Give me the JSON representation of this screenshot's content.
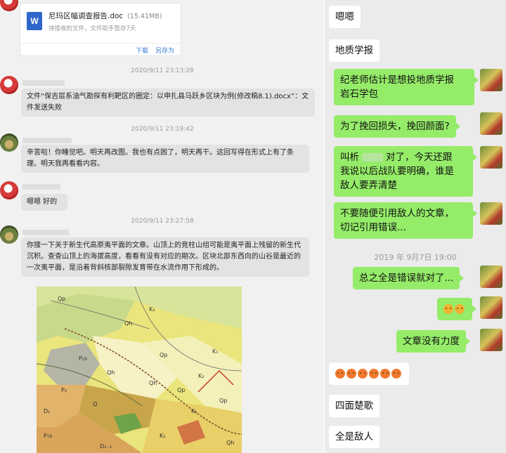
{
  "left": {
    "file": {
      "name": "尼玛区幅调查报告.doc",
      "size": "(15.41MB)",
      "status": "待接收的文件，文件助手暂存7天",
      "download": "下载",
      "save_as": "另存为",
      "icon": "W"
    },
    "messages": [
      {
        "time": "2020/9/11 23:13:28",
        "text": "文件“保吉层系油气勘探有利靶区的圈定：以申扎县马跃乡区块为例(修改稿8.1).docx”：文件发送失败"
      },
      {
        "time": "2020/9/11 23:19:42",
        "text": "辛苦啦！你睡觉吧。明天再改图。我也有点困了，明天再干。这回写得在形式上有了条理。明天我再看看内容。"
      },
      {
        "text": "嗯嗯 好的"
      },
      {
        "time": "2020/9/11 23:27:58",
        "text": "你搜一下关于新生代高原夷平面的文章。山顶上的竞柱山组可能是夷平面上残留的新生代沉积。查查山顶上的海拔高度，看看有没有对应的期次。区块北部东西向的山谷是最近的一次夷平面，是沿着背斜核部裂隙发育带在水流作用下形成的。"
      }
    ],
    "map_labels": [
      "Qp",
      "Qh",
      "K₂",
      "P₂s",
      "Qh",
      "Qp",
      "K₁",
      "K₂",
      "Qp",
      "Qh",
      "P₂",
      "Q",
      "D₁",
      "D₂₋₃",
      "P₁s",
      "K₁",
      "Qp",
      "Qh",
      "K₂"
    ]
  },
  "right": {
    "messages": [
      {
        "text": "嗯嗯",
        "side": "left"
      },
      {
        "text": "地质学报",
        "side": "left"
      },
      {
        "text": "纪老师估计是想投地质学报",
        "line2": "岩石学包",
        "side": "right"
      },
      {
        "text": "为了挽回损失，挽回颜面?",
        "side": "right"
      },
      {
        "text": "叫析",
        "text_b": "对了，今天还跟",
        "line2": "我说以后战队要明确，谁是",
        "line3": "敌人要弄清楚",
        "side": "right"
      },
      {
        "text": "不要随便引用敌人的文章，",
        "line2": "切记引用错误...",
        "side": "right"
      },
      {
        "time": "2019 年 9月7日 19:00"
      },
      {
        "text": "总之全是错误就对了...",
        "side": "right"
      },
      {
        "text": "emoji-pair",
        "side": "right"
      },
      {
        "text": "文章没有力度",
        "side": "right"
      },
      {
        "text": "emoji-row",
        "side": "left"
      },
      {
        "text": "四面楚歌",
        "side": "left"
      },
      {
        "text": "全是敌人",
        "side": "left"
      }
    ]
  }
}
